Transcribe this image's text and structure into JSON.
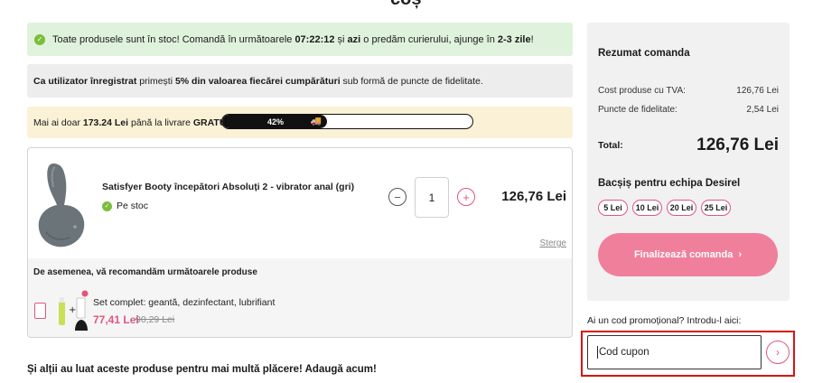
{
  "page_title_fragment": "coș",
  "stock_banner": {
    "text_1": "Toate produsele sunt în stoc! Comandă în următoarele ",
    "timer": "07:22:12",
    "text_2": " și ",
    "today": "azi",
    "text_3": " o predăm curierului, ajunge în ",
    "days": "2-3 zile",
    "text_4": "!"
  },
  "loyalty_banner": {
    "text_1": "Ca utilizator înregistrat",
    "text_2": " primești ",
    "bold_2": "5% din valoarea fiecărei cumpărături",
    "text_3": " sub formă de puncte de fidelitate."
  },
  "shipping_banner": {
    "text_1": "Mai ai doar ",
    "amount": "173.24 Lei",
    "text_2": " până la livrare ",
    "free": "GRATUITĂ",
    "text_3": "!",
    "progress_label": "42%",
    "progress_fraction": 0.42
  },
  "cart_item": {
    "name": "Satisfyer Booty începători Absoluți 2 - vibrator anal (gri)",
    "stock_status": "Pe stoc",
    "quantity": "1",
    "minus_label": "−",
    "plus_label": "+",
    "price": "126,76 Lei",
    "remove_label": "Sterge"
  },
  "recommendation": {
    "title": "De asemenea, vă recomandăm următoarele produse",
    "name": "Set complet: geantă, dezinfectant, lubrifiant",
    "price": "77,41 Lei",
    "old_price": "90,29 Lei"
  },
  "also_bought": "Și alții au luat aceste produse pentru mai multă plăcere! Adaugă acum!",
  "summary": {
    "title": "Rezumat comanda",
    "cost_label": "Cost produse cu TVA:",
    "cost_value": "126,76 Lei",
    "points_label": "Puncte de fidelitate:",
    "points_value": "2,54 Lei",
    "total_label": "Total:",
    "total_value": "126,76 Lei",
    "tip_title": "Bacșiș pentru echipa Desirel",
    "tips": [
      "5 Lei",
      "10 Lei",
      "20 Lei",
      "25 Lei"
    ],
    "checkout_label": "Finalizează comanda",
    "checkout_arrow": "›"
  },
  "coupon": {
    "label": "Ai un cod promoțional? Introdu-l aici:",
    "placeholder": "Cod cupon",
    "apply_arrow": "›"
  },
  "colors": {
    "accent_pink": "#e0567d",
    "checkout_pink": "#f07f9c",
    "success_green": "#7cbd3c",
    "highlight_red": "#d81414"
  }
}
